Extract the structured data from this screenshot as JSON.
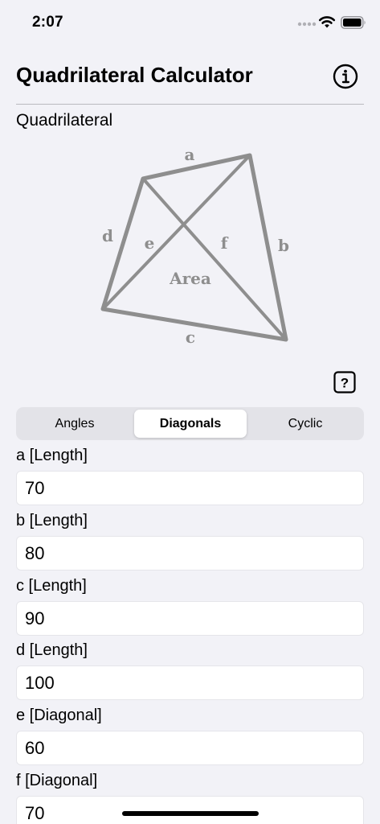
{
  "status_bar": {
    "time": "2:07",
    "icons": [
      "signal-dots-icon",
      "wifi-icon",
      "battery-icon"
    ]
  },
  "header": {
    "title": "Quadrilateral Calculator",
    "info_icon": "info-circle-icon"
  },
  "section": {
    "title": "Quadrilateral"
  },
  "diagram": {
    "labels": {
      "a": "a",
      "b": "b",
      "c": "c",
      "d": "d",
      "e": "e",
      "f": "f",
      "area": "Area"
    },
    "line_color": "#8e8e8e"
  },
  "help_button": {
    "label": "?"
  },
  "segments": {
    "selected": "Diagonals",
    "items": [
      "Angles",
      "Diagonals",
      "Cyclic"
    ]
  },
  "fields": [
    {
      "label": "a [Length]",
      "value": "70"
    },
    {
      "label": "b [Length]",
      "value": "80"
    },
    {
      "label": "c [Length]",
      "value": "90"
    },
    {
      "label": "d [Length]",
      "value": "100"
    },
    {
      "label": "e [Diagonal]",
      "value": "60"
    },
    {
      "label": "f [Diagonal]",
      "value": "70"
    }
  ]
}
